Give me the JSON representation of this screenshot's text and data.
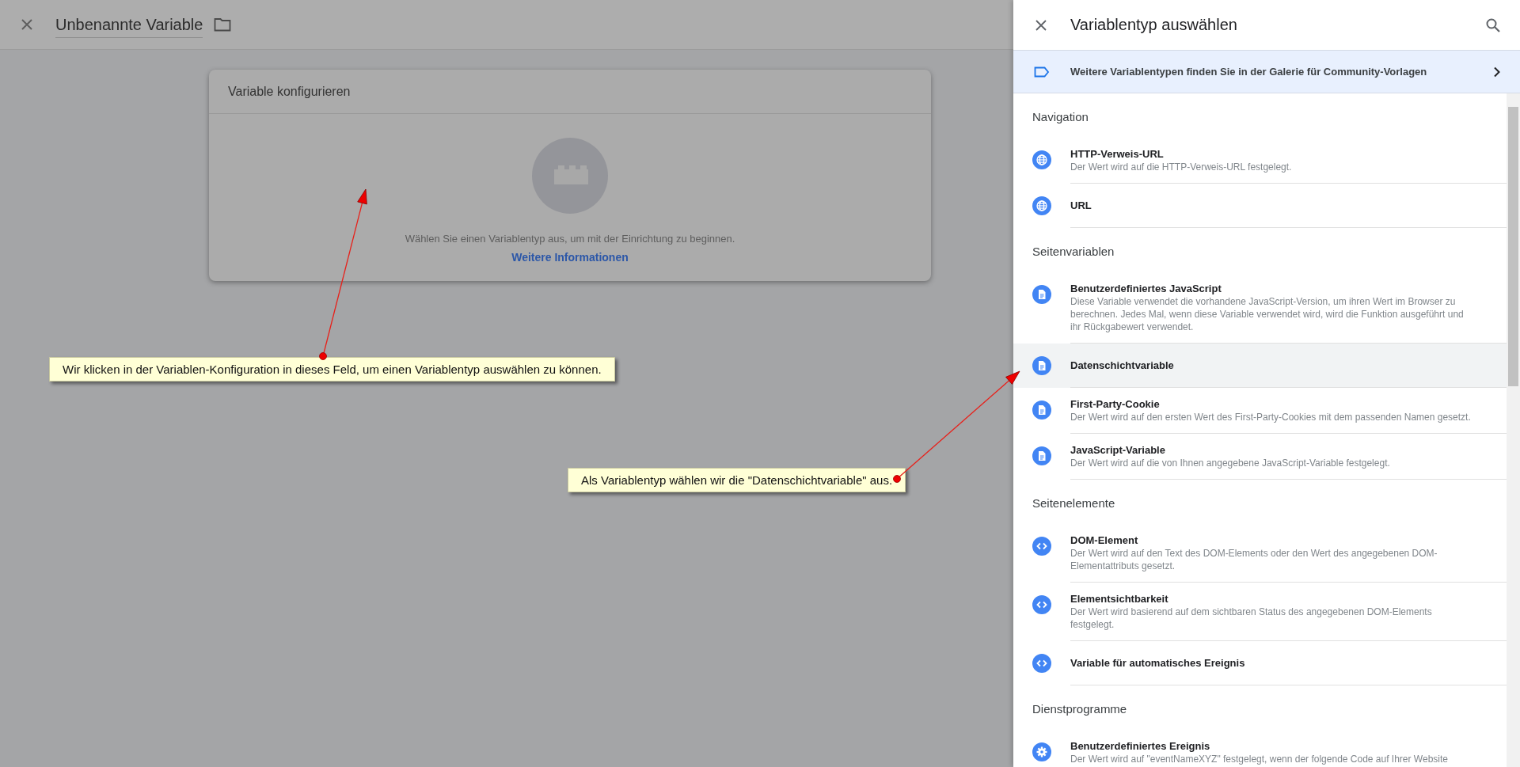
{
  "header": {
    "title": "Unbenannte Variable"
  },
  "card": {
    "title": "Variable konfigurieren",
    "message": "Wählen Sie einen Variablentyp aus, um mit der Einrichtung zu beginnen.",
    "link": "Weitere Informationen"
  },
  "panel": {
    "title": "Variablentyp auswählen",
    "banner": "Weitere Variablentypen finden Sie in der Galerie für Community-Vorlagen",
    "sections": [
      {
        "title": "Navigation",
        "items": [
          {
            "name": "HTTP-Verweis-URL",
            "description": "Der Wert wird auf die HTTP-Verweis-URL festgelegt.",
            "kind": "globe",
            "selected": false
          },
          {
            "name": "URL",
            "kind": "globe",
            "selected": false
          }
        ]
      },
      {
        "title": "Seitenvariablen",
        "items": [
          {
            "name": "Benutzerdefiniertes JavaScript",
            "description": "Diese Variable verwendet die vorhandene JavaScript-Version, um ihren Wert im Browser zu berechnen. Jedes Mal, wenn diese Variable verwendet wird, wird die Funktion ausgeführt und ihr Rückgabewert verwendet.",
            "kind": "document",
            "selected": false
          },
          {
            "name": "Datenschichtvariable",
            "kind": "document",
            "selected": true
          },
          {
            "name": "First-Party-Cookie",
            "description": "Der Wert wird auf den ersten Wert des First-Party-Cookies mit dem passenden Namen gesetzt.",
            "kind": "document",
            "selected": false
          },
          {
            "name": "JavaScript-Variable",
            "description": "Der Wert wird auf die von Ihnen angegebene JavaScript-Variable festgelegt.",
            "kind": "document",
            "selected": false
          }
        ]
      },
      {
        "title": "Seitenelemente",
        "items": [
          {
            "name": "DOM-Element",
            "description": "Der Wert wird auf den Text des DOM-Elements oder den Wert des angegebenen DOM-Elementattributs gesetzt.",
            "kind": "code",
            "selected": false
          },
          {
            "name": "Elementsichtbarkeit",
            "description": "Der Wert wird basierend auf dem sichtbaren Status des angegebenen DOM-Elements festgelegt.",
            "kind": "code",
            "selected": false
          },
          {
            "name": "Variable für automatisches Ereignis",
            "kind": "code",
            "selected": false
          }
        ]
      },
      {
        "title": "Dienstprogramme",
        "items": [
          {
            "name": "Benutzerdefiniertes Ereignis",
            "description": "Der Wert wird auf \"eventNameXYZ\" festgelegt, wenn der folgende Code auf Ihrer Website",
            "kind": "gear",
            "selected": false
          }
        ]
      }
    ]
  },
  "annotations": [
    {
      "text": "Wir klicken in der Variablen-Konfiguration in dieses Feld, um einen Variablentyp auswählen zu können."
    },
    {
      "text": "Als Variablentyp wählen wir die \"Datenschichtvariable\" aus."
    }
  ]
}
